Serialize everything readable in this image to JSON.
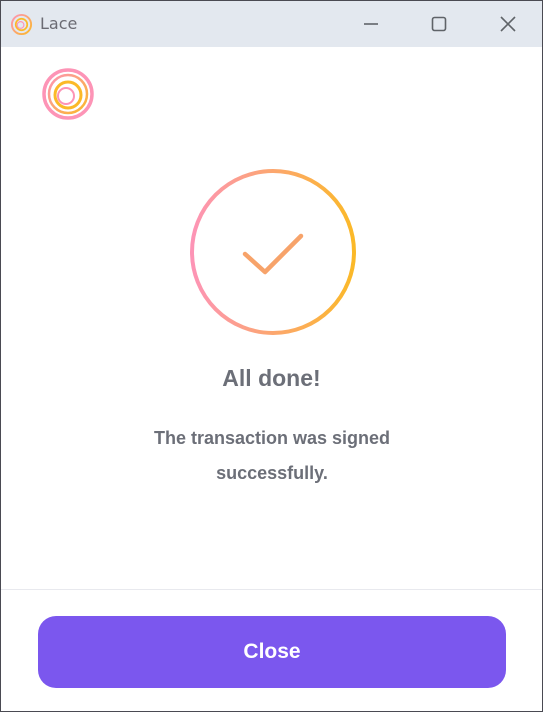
{
  "window": {
    "title": "Lace",
    "app_icon": "lace-logo-icon",
    "controls": {
      "minimize_icon": "minimize-icon",
      "maximize_icon": "maximize-icon",
      "close_icon": "close-icon"
    }
  },
  "main": {
    "logo_icon": "lace-logo-icon",
    "status_icon": "checkmark-circle-icon",
    "heading": "All done!",
    "message": "The transaction was signed successfully."
  },
  "footer": {
    "close_label": "Close"
  },
  "colors": {
    "titlebar_bg": "#e3e8ef",
    "button_bg": "#7b57ee",
    "text": "#6c6f78",
    "gradient_start": "#fd94b6",
    "gradient_end": "#fbb928"
  }
}
